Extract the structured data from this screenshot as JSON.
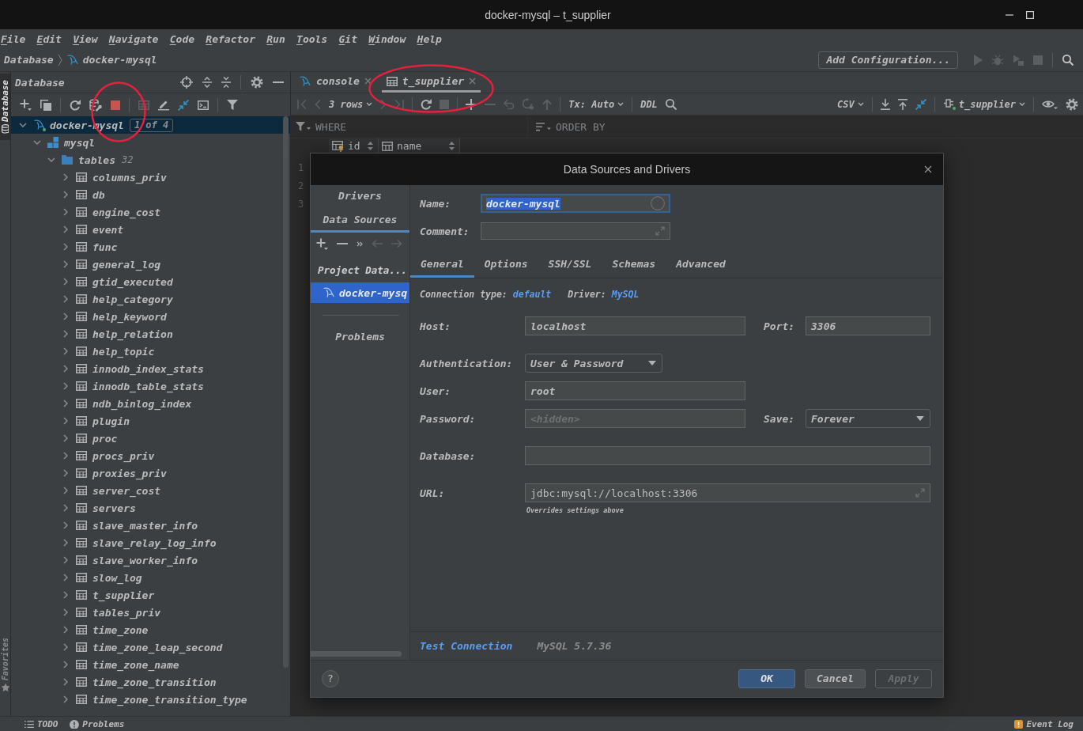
{
  "window": {
    "title": "docker-mysql – t_supplier"
  },
  "menu": [
    "File",
    "Edit",
    "View",
    "Navigate",
    "Code",
    "Refactor",
    "Run",
    "Tools",
    "Git",
    "Window",
    "Help"
  ],
  "navigation_bar": {
    "breadcrumb": [
      "Database",
      "docker-mysql"
    ],
    "configuration": "Add Configuration...",
    "run_actions": [
      {
        "disabled": true
      },
      {
        "disabled": true
      },
      {
        "disabled": true
      },
      {
        "disabled": true
      }
    ]
  },
  "side_stripe": {
    "top": [
      {
        "label": "Database",
        "selected": true
      }
    ],
    "bottom": [
      {
        "label": "Favorites",
        "selected": false
      }
    ]
  },
  "tool_window": {
    "title": "Database",
    "toolbar": [
      [
        {
          "disabled": false,
          "circled": false
        },
        {
          "disabled": false,
          "circled": false
        }
      ],
      [
        {
          "disabled": false,
          "circled": false
        },
        {
          "disabled": false,
          "circled": false
        },
        {
          "disabled": false,
          "circled": true
        }
      ],
      [
        {
          "disabled": true,
          "circled": false
        },
        {
          "disabled": false,
          "circled": false
        },
        {
          "disabled": false,
          "circled": false
        },
        {
          "disabled": false,
          "circled": false
        }
      ],
      [
        {
          "disabled": false,
          "circled": false
        }
      ]
    ],
    "tree": [
      {
        "label": "docker-mysql",
        "kind": "datasource",
        "badge": "1 of 4",
        "connected": true,
        "selected": true,
        "expanded": true,
        "children": [
          {
            "label": "mysql",
            "kind": "schema",
            "selected": false,
            "expanded": true,
            "children": [
              {
                "label": "tables",
                "kind": "folder",
                "count": "32",
                "selected": false,
                "expanded": true,
                "children": [
                  {
                    "label": "columns_priv",
                    "kind": "table",
                    "selected": false,
                    "expanded": false
                  },
                  {
                    "label": "db",
                    "kind": "table",
                    "selected": false,
                    "expanded": false
                  },
                  {
                    "label": "engine_cost",
                    "kind": "table",
                    "selected": false,
                    "expanded": false
                  },
                  {
                    "label": "event",
                    "kind": "table",
                    "selected": false,
                    "expanded": false
                  },
                  {
                    "label": "func",
                    "kind": "table",
                    "selected": false,
                    "expanded": false
                  },
                  {
                    "label": "general_log",
                    "kind": "table",
                    "selected": false,
                    "expanded": false
                  },
                  {
                    "label": "gtid_executed",
                    "kind": "table",
                    "selected": false,
                    "expanded": false
                  },
                  {
                    "label": "help_category",
                    "kind": "table",
                    "selected": false,
                    "expanded": false
                  },
                  {
                    "label": "help_keyword",
                    "kind": "table",
                    "selected": false,
                    "expanded": false
                  },
                  {
                    "label": "help_relation",
                    "kind": "table",
                    "selected": false,
                    "expanded": false
                  },
                  {
                    "label": "help_topic",
                    "kind": "table",
                    "selected": false,
                    "expanded": false
                  },
                  {
                    "label": "innodb_index_stats",
                    "kind": "table",
                    "selected": false,
                    "expanded": false
                  },
                  {
                    "label": "innodb_table_stats",
                    "kind": "table",
                    "selected": false,
                    "expanded": false
                  },
                  {
                    "label": "ndb_binlog_index",
                    "kind": "table",
                    "selected": false,
                    "expanded": false
                  },
                  {
                    "label": "plugin",
                    "kind": "table",
                    "selected": false,
                    "expanded": false
                  },
                  {
                    "label": "proc",
                    "kind": "table",
                    "selected": false,
                    "expanded": false
                  },
                  {
                    "label": "procs_priv",
                    "kind": "table",
                    "selected": false,
                    "expanded": false
                  },
                  {
                    "label": "proxies_priv",
                    "kind": "table",
                    "selected": false,
                    "expanded": false
                  },
                  {
                    "label": "server_cost",
                    "kind": "table",
                    "selected": false,
                    "expanded": false
                  },
                  {
                    "label": "servers",
                    "kind": "table",
                    "selected": false,
                    "expanded": false
                  },
                  {
                    "label": "slave_master_info",
                    "kind": "table",
                    "selected": false,
                    "expanded": false
                  },
                  {
                    "label": "slave_relay_log_info",
                    "kind": "table",
                    "selected": false,
                    "expanded": false
                  },
                  {
                    "label": "slave_worker_info",
                    "kind": "table",
                    "selected": false,
                    "expanded": false
                  },
                  {
                    "label": "slow_log",
                    "kind": "table",
                    "selected": false,
                    "expanded": false
                  },
                  {
                    "label": "t_supplier",
                    "kind": "table",
                    "selected": false,
                    "expanded": false
                  },
                  {
                    "label": "tables_priv",
                    "kind": "table",
                    "selected": false,
                    "expanded": false
                  },
                  {
                    "label": "time_zone",
                    "kind": "table",
                    "selected": false,
                    "expanded": false
                  },
                  {
                    "label": "time_zone_leap_second",
                    "kind": "table",
                    "selected": false,
                    "expanded": false
                  },
                  {
                    "label": "time_zone_name",
                    "kind": "table",
                    "selected": false,
                    "expanded": false
                  },
                  {
                    "label": "time_zone_transition",
                    "kind": "table",
                    "selected": false,
                    "expanded": false
                  },
                  {
                    "label": "time_zone_transition_type",
                    "kind": "table",
                    "selected": false,
                    "expanded": false
                  }
                ]
              }
            ]
          }
        ]
      }
    ]
  },
  "editor": {
    "tabs": [
      {
        "label": "console",
        "kind": "console",
        "selected": false,
        "circled": false
      },
      {
        "label": "t_supplier",
        "kind": "table",
        "selected": true,
        "circled": true
      }
    ],
    "grid_toolbar": {
      "left": [
        [
          {
            "disabled": true
          },
          {
            "disabled": true
          },
          {
            "label": "3 rows",
            "dropdown": true
          },
          {
            "disabled": true
          },
          {
            "disabled": true
          }
        ],
        [
          {
            "disabled": false
          },
          {
            "disabled": true
          }
        ],
        [
          {
            "disabled": false
          },
          {
            "disabled": true
          },
          {
            "disabled": true
          },
          {
            "disabled": true
          },
          {
            "disabled": true
          }
        ],
        [
          {
            "label": "Tx: Auto",
            "dropdown": true
          }
        ],
        [
          {
            "label": "DDL",
            "dropdown": false
          },
          {
            "disabled": false
          }
        ]
      ],
      "right": [
        [
          {
            "label": "CSV",
            "dropdown": true
          }
        ],
        [
          {
            "disabled": false
          },
          {
            "disabled": false
          },
          {
            "disabled": false
          }
        ],
        [
          {
            "label": "t_supplier",
            "dropdown": true,
            "connected": true
          }
        ],
        [
          {
            "disabled": false
          },
          {
            "disabled": false
          }
        ]
      ]
    },
    "filter": {
      "where": "WHERE",
      "order_by": "ORDER BY"
    },
    "columns": [
      {
        "name": "id",
        "kind": "key"
      },
      {
        "name": "name",
        "kind": "column"
      }
    ],
    "row_numbers": [
      "1",
      "2",
      "3"
    ]
  },
  "dialog": {
    "title": "Data Sources and Drivers",
    "nav_tabs": [
      {
        "label": "Drivers",
        "selected": false
      },
      {
        "label": "Data Sources",
        "selected": true
      }
    ],
    "nav_toolbar": [
      {
        "disabled": false
      },
      {
        "disabled": false
      },
      {
        "disabled": false
      },
      {
        "disabled": true
      },
      {
        "disabled": true
      }
    ],
    "group": "Project Data...",
    "sources": [
      {
        "label": "docker-mysq",
        "selected": true
      }
    ],
    "problems": "Problems",
    "name": {
      "label": "Name:",
      "value": "docker-mysql",
      "focused": true,
      "text_selected": true
    },
    "comment": {
      "label": "Comment:"
    },
    "tabs": [
      {
        "label": "General",
        "selected": true
      },
      {
        "label": "Options",
        "selected": false
      },
      {
        "label": "SSH/SSL",
        "selected": false
      },
      {
        "label": "Schemas",
        "selected": false
      },
      {
        "label": "Advanced",
        "selected": false
      }
    ],
    "connection_type": {
      "label": "Connection type:",
      "value": "default"
    },
    "driver": {
      "label": "Driver:",
      "value": "MySQL"
    },
    "host": {
      "label": "Host:",
      "value": "localhost"
    },
    "port": {
      "label": "Port:",
      "value": "3306"
    },
    "authentication": {
      "label": "Authentication:",
      "value": "User & Password"
    },
    "user": {
      "label": "User:",
      "value": "root"
    },
    "password": {
      "label": "Password:",
      "placeholder": "<hidden>"
    },
    "save": {
      "label": "Save:",
      "value": "Forever"
    },
    "database": {
      "label": "Database:"
    },
    "url": {
      "label": "URL:",
      "value": "jdbc:mysql://localhost:3306",
      "hint": "Overrides settings above"
    },
    "test_connection": "Test Connection",
    "server_version": "MySQL 5.7.36",
    "help": "?",
    "buttons": [
      {
        "label": "OK",
        "kind": "primary",
        "disabled": false
      },
      {
        "label": "Cancel",
        "kind": "secondary",
        "disabled": false
      },
      {
        "label": "Apply",
        "kind": "secondary",
        "disabled": true
      }
    ]
  },
  "status_bar": {
    "left": [
      "TODO",
      "Problems"
    ],
    "right": [
      "Event Log"
    ]
  }
}
